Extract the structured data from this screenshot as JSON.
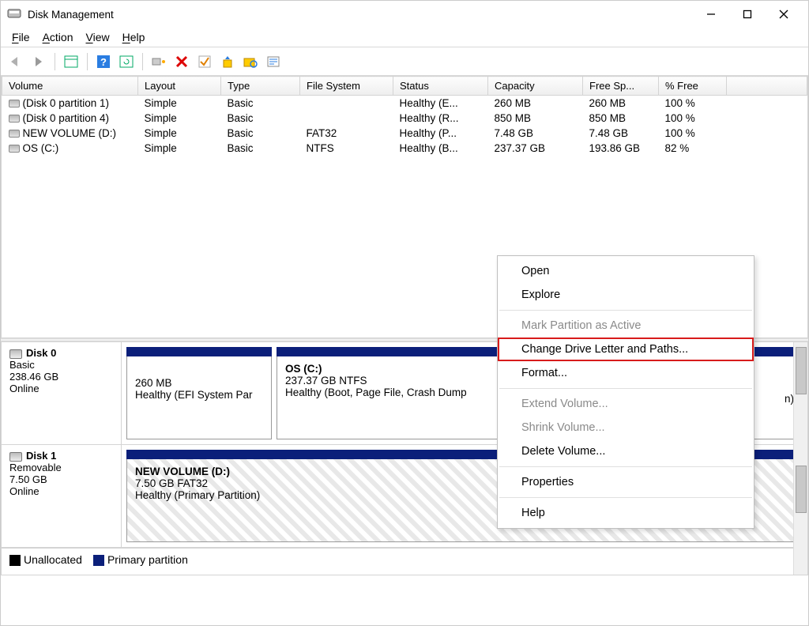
{
  "window": {
    "title": "Disk Management"
  },
  "menu": {
    "file": "File",
    "action": "Action",
    "view": "View",
    "help": "Help"
  },
  "columns": {
    "volume": "Volume",
    "layout": "Layout",
    "type": "Type",
    "fs": "File System",
    "status": "Status",
    "capacity": "Capacity",
    "free": "Free Sp...",
    "pct": "% Free"
  },
  "rows": [
    {
      "volume": "(Disk 0 partition 1)",
      "layout": "Simple",
      "type": "Basic",
      "fs": "",
      "status": "Healthy (E...",
      "capacity": "260 MB",
      "free": "260 MB",
      "pct": "100 %"
    },
    {
      "volume": "(Disk 0 partition 4)",
      "layout": "Simple",
      "type": "Basic",
      "fs": "",
      "status": "Healthy (R...",
      "capacity": "850 MB",
      "free": "850 MB",
      "pct": "100 %"
    },
    {
      "volume": "NEW VOLUME (D:)",
      "layout": "Simple",
      "type": "Basic",
      "fs": "FAT32",
      "status": "Healthy (P...",
      "capacity": "7.48 GB",
      "free": "7.48 GB",
      "pct": "100 %"
    },
    {
      "volume": "OS (C:)",
      "layout": "Simple",
      "type": "Basic",
      "fs": "NTFS",
      "status": "Healthy (B...",
      "capacity": "237.37 GB",
      "free": "193.86 GB",
      "pct": "82 %"
    }
  ],
  "disks": {
    "d0": {
      "name": "Disk 0",
      "type": "Basic",
      "size": "238.46 GB",
      "state": "Online",
      "p0": {
        "size": "260 MB",
        "status": "Healthy (EFI System Par"
      },
      "p1": {
        "title": "OS  (C:)",
        "line1": "237.37 GB NTFS",
        "line2": "Healthy (Boot, Page File, Crash Dump"
      },
      "p2": {
        "trail": "n)"
      }
    },
    "d1": {
      "name": "Disk 1",
      "type": "Removable",
      "size": "7.50 GB",
      "state": "Online",
      "p0": {
        "title": "NEW VOLUME  (D:)",
        "line1": "7.50 GB FAT32",
        "line2": "Healthy (Primary Partition)"
      }
    }
  },
  "legend": {
    "unalloc": "Unallocated",
    "primary": "Primary partition"
  },
  "ctx": {
    "open": "Open",
    "explore": "Explore",
    "mark": "Mark Partition as Active",
    "change": "Change Drive Letter and Paths...",
    "format": "Format...",
    "extend": "Extend Volume...",
    "shrink": "Shrink Volume...",
    "delete": "Delete Volume...",
    "props": "Properties",
    "help": "Help"
  }
}
